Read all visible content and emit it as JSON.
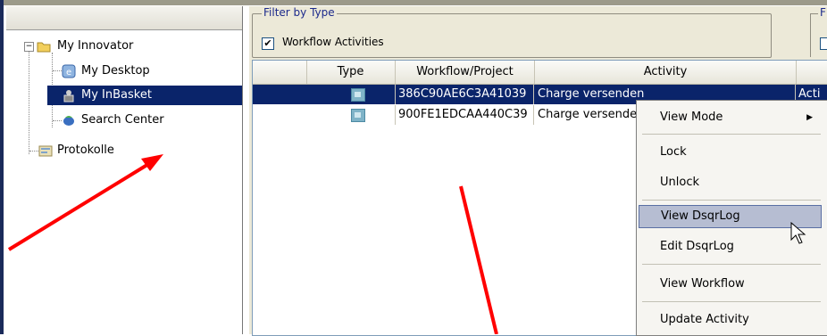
{
  "tree": {
    "root_label": "My Innovator",
    "items": [
      {
        "label": "My Desktop",
        "icon": "desktop-icon"
      },
      {
        "label": "My InBasket",
        "icon": "inbasket-icon"
      },
      {
        "label": "Search Center",
        "icon": "search-center-icon"
      }
    ],
    "sibling_label": "Protokolle"
  },
  "filter": {
    "legend": "Filter by Type",
    "checkbox_label": "Workflow Activities",
    "checked_mark": "✔",
    "second_legend": "F"
  },
  "grid": {
    "headers": [
      "Type",
      "Workflow/Project",
      "Activity"
    ],
    "rows": [
      {
        "workflow": "386C90AE6C3A41039",
        "activity": "Charge versenden",
        "extra": "Acti"
      },
      {
        "workflow": "900FE1EDCAA440C39",
        "activity": "Charge versenden",
        "extra": ""
      }
    ]
  },
  "context_menu": {
    "items": [
      "View Mode",
      "Lock",
      "Unlock",
      "View DsqrLog",
      "Edit DsqrLog",
      "View Workflow",
      "Update Activity"
    ],
    "submenu_arrow": "▶"
  },
  "colors": {
    "selection": "#0a246a",
    "annotation_arrow": "#ff0000",
    "menu_hover": "#b6bdd2"
  }
}
